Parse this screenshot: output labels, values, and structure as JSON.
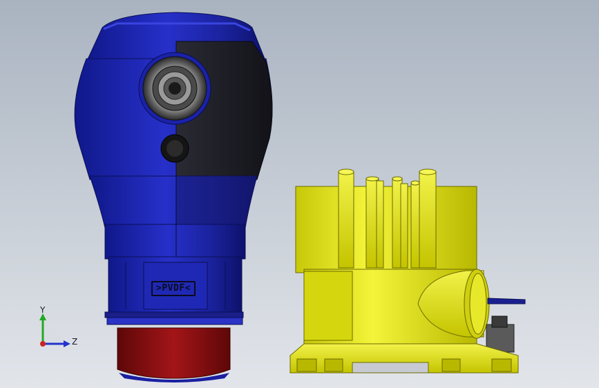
{
  "viewport": {
    "background_top": "#a9b3c0",
    "background_bottom": "#e2e5ea"
  },
  "sensor_part": {
    "body_color": "#1d25a8",
    "dark_side_color": "#1b1b24",
    "thread_color": "#8a0f12",
    "label_text": ">PVDF<"
  },
  "bracket_part": {
    "color": "#e6e617"
  },
  "triad": {
    "y_label": "Y",
    "z_label": "Z",
    "y_color": "#22aa22",
    "z_color": "#2233cc",
    "origin_color": "#cc2222"
  }
}
